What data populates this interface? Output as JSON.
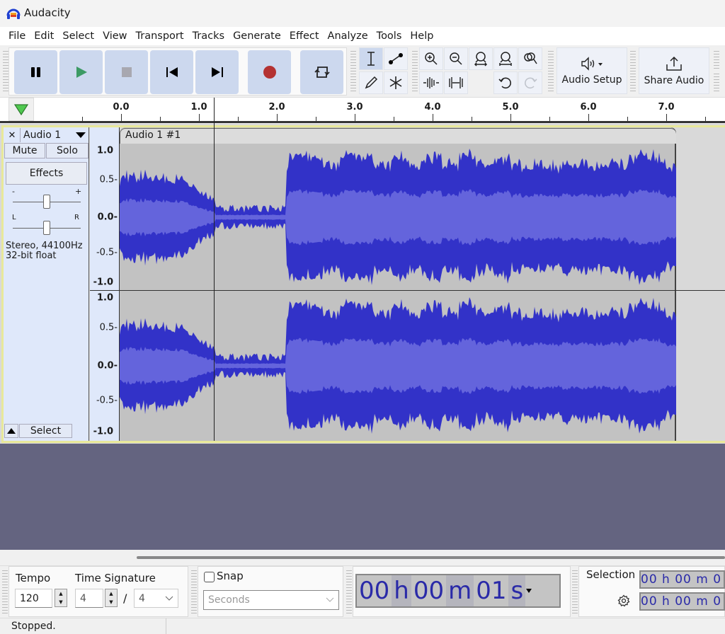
{
  "window": {
    "title": "Audacity"
  },
  "menu": [
    "File",
    "Edit",
    "Select",
    "View",
    "Transport",
    "Tracks",
    "Generate",
    "Effect",
    "Analyze",
    "Tools",
    "Help"
  ],
  "transport": {
    "pause": "pause",
    "play": "play",
    "stop": "stop",
    "skip_start": "skip-to-start",
    "skip_end": "skip-to-end",
    "record": "record",
    "loop": "loop"
  },
  "tools": {
    "audio_setup": "Audio Setup",
    "share_audio": "Share Audio"
  },
  "colors": {
    "waveform_outer": "#3232c8",
    "waveform_inner": "#6464dc",
    "clip_bg": "#c2c2c2",
    "track_panel": "#dfe8fa",
    "track_border": "#e8e89a",
    "background": "#646480",
    "play": "#3c9a64",
    "record": "#b43232",
    "timer_text": "#2a2aa8"
  },
  "ruler": {
    "ticks": [
      "0.0",
      "1.0",
      "2.0",
      "3.0",
      "4.0",
      "5.0",
      "6.0",
      "7.0"
    ]
  },
  "track": {
    "name": "Audio 1",
    "mute": "Mute",
    "solo": "Solo",
    "effects": "Effects",
    "gain_minus": "-",
    "gain_plus": "+",
    "pan_left": "L",
    "pan_right": "R",
    "info_line1": "Stereo, 44100Hz",
    "info_line2": "32-bit float",
    "select": "Select",
    "clip_name": "Audio 1 #1",
    "gain": 0.5,
    "pan": 0.5,
    "scale": [
      "1.0",
      "0.5-",
      "0.0-",
      "-0.5-",
      "-1.0"
    ]
  },
  "bottom": {
    "tempo_label": "Tempo",
    "tempo_value": "120",
    "time_sig_label": "Time Signature",
    "time_sig_num": "4",
    "time_sig_slash": "/",
    "time_sig_den": "4",
    "snap_label": "Snap",
    "snap_checked": false,
    "snap_unit": "Seconds",
    "timer": {
      "hh": "00",
      "h": "h",
      "mm": "00",
      "m": "m",
      "ss": "01",
      "s": "s"
    },
    "selection_label": "Selection",
    "sel_start": "00 h 00 m 0",
    "sel_end": "00 h 00 m 0"
  },
  "status": {
    "text": "Stopped."
  }
}
